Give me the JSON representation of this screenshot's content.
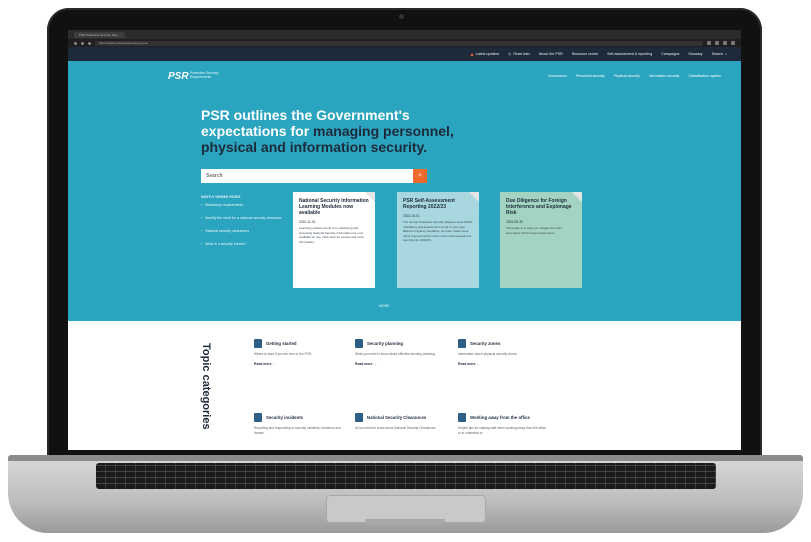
{
  "browser": {
    "tab_title": "PSR Protective Security Req...",
    "url": "https://www.protectivesecurity.gov.au"
  },
  "utility_bar": {
    "latest_updates": "Latest updates",
    "read_later": "Read later",
    "about": "About the PSR",
    "resource_centre": "Resource centre",
    "self_assessment": "Self-assessment & reporting",
    "campaigns": "Campaigns",
    "glossary": "Glossary",
    "search": "Search"
  },
  "logo": {
    "mark": "PSR",
    "subtitle": "Protective Security Requirements"
  },
  "main_nav": [
    "Governance",
    "Personnel security",
    "Physical security",
    "Information security",
    "Classification system"
  ],
  "hero": {
    "headline_part1": "PSR outlines the Government's expectations for",
    "headline_part2": "managing personnel, physical and information security.",
    "search_placeholder": "Search",
    "popular_title": "MOSTLY VIEWED PAGES",
    "popular_links": [
      "Mandatory requirements",
      "Identify the need for a national security clearance",
      "National security clearances",
      "What is a security breach?"
    ],
    "more_label": "MORE"
  },
  "cards": [
    {
      "title": "National Security Information Learning Modules now available",
      "date": "2022-11-01",
      "body": "Learning modules found if on classifying and protecting National Security Information are now available for use. Click here for access and more information."
    },
    {
      "title": "PSR Self-Assessment Reporting 2022/23",
      "date": "2022-10-01",
      "body": "The annual Protective Security Requirements (PSR) mandatory self-assessment round is now open. Based on agency feedback, we have made some minor improvements to the current self-assessment reporting for 2022/23."
    },
    {
      "title": "Due Diligence for Foreign Interference and Espionage Risk",
      "date": "2022-09-30",
      "body": "This guide is to help you mitigate the risks associated with Foreign Interference."
    }
  ],
  "topics": {
    "heading": "Topic categories",
    "more_label": "Read more",
    "items": [
      {
        "title": "Getting started",
        "desc": "Where to start if you are new to the PSR.",
        "icon": "document-icon"
      },
      {
        "title": "Security planning",
        "desc": "What you need to know about effective security planning.",
        "icon": "checklist-icon"
      },
      {
        "title": "Security zones",
        "desc": "Information about physical security zones.",
        "icon": "building-icon"
      },
      {
        "title": "Security incidents",
        "desc": "Reporting and responding to security incidents, breaches and threats.",
        "icon": "shield-icon"
      },
      {
        "title": "National Security Clearances",
        "desc": "All you need to know about National Security Clearances.",
        "icon": "id-card-icon"
      },
      {
        "title": "Working away from the office",
        "desc": "Helpful tips for staying safe when working away from the office or in unfamiliar or",
        "icon": "laptop-icon"
      }
    ]
  },
  "colors": {
    "hero_bg": "#2aa4bf",
    "utility_bg": "#1d2a3a",
    "accent": "#f06a2c"
  }
}
